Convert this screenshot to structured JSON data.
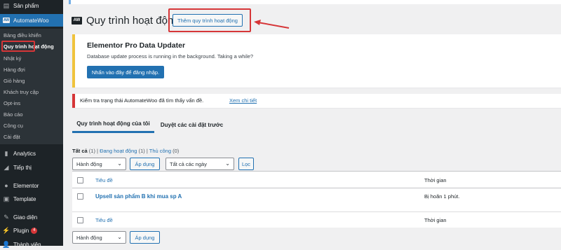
{
  "sidebar": {
    "top_item": {
      "label": "Sản phẩm",
      "icon": "product-icon"
    },
    "active_item": {
      "label": "AutomateWoo",
      "icon": "automatewoo-icon",
      "logo_text": "AW"
    },
    "submenu": [
      {
        "label": "Bảng điều khiển"
      },
      {
        "label": "Quy trình hoạt động"
      },
      {
        "label": "Nhật ký"
      },
      {
        "label": "Hàng đợi"
      },
      {
        "label": "Giỏ hàng"
      },
      {
        "label": "Khách truy cập"
      },
      {
        "label": "Opt-ins"
      },
      {
        "label": "Báo cáo"
      },
      {
        "label": "Công cụ"
      },
      {
        "label": "Cài đặt"
      }
    ],
    "items": [
      {
        "label": "Analytics",
        "icon": "analytics-icon"
      },
      {
        "label": "Tiếp thị",
        "icon": "megaphone-icon"
      },
      {
        "label": "Elementor",
        "icon": "elementor-icon"
      },
      {
        "label": "Template",
        "icon": "template-icon"
      },
      {
        "label": "Giao diện",
        "icon": "paintbrush-icon"
      },
      {
        "label": "Plugin",
        "icon": "plugin-icon",
        "badge": "4"
      },
      {
        "label": "Thành viên",
        "icon": "users-icon"
      }
    ],
    "colors": {
      "bg": "#1d2327",
      "active": "#2271b1",
      "highlight": "#d63638"
    }
  },
  "header": {
    "logo_text": "AW",
    "title": "Quy trình hoạt động",
    "add_button": "Thêm quy trình hoạt động"
  },
  "elementor_notice": {
    "title": "Elementor Pro Data Updater",
    "message": "Database update process is running in the background. Taking a while?",
    "button": "Nhấn vào đây để đăng nhập."
  },
  "status_notice": {
    "message": "Kiểm tra trạng thái AutomateWoo đã tìm thấy vấn đề.",
    "link": "Xem chi tiết"
  },
  "tabs": [
    {
      "label": "Quy trình hoạt động của tôi",
      "active": true
    },
    {
      "label": "Duyệt các cài đặt trước",
      "active": false
    }
  ],
  "filters": {
    "all": "Tất cả",
    "all_count": "(1)",
    "active": "Đang hoạt động",
    "active_count": "(1)",
    "manual": "Thủ công",
    "manual_count": "(0)",
    "sep": "|"
  },
  "bulk_top": {
    "action": "Hành động",
    "apply": "Áp dụng",
    "dates": "Tất cả các ngày",
    "filter": "Lọc"
  },
  "table": {
    "columns": {
      "title": "Tiêu đề",
      "time": "Thời gian"
    },
    "rows": [
      {
        "title": "Upsell sản phẩm B khi mua sp A",
        "time": "Bị hoãn 1 phút."
      }
    ]
  },
  "bulk_bottom": {
    "action": "Hành động",
    "apply": "Áp dụng"
  }
}
